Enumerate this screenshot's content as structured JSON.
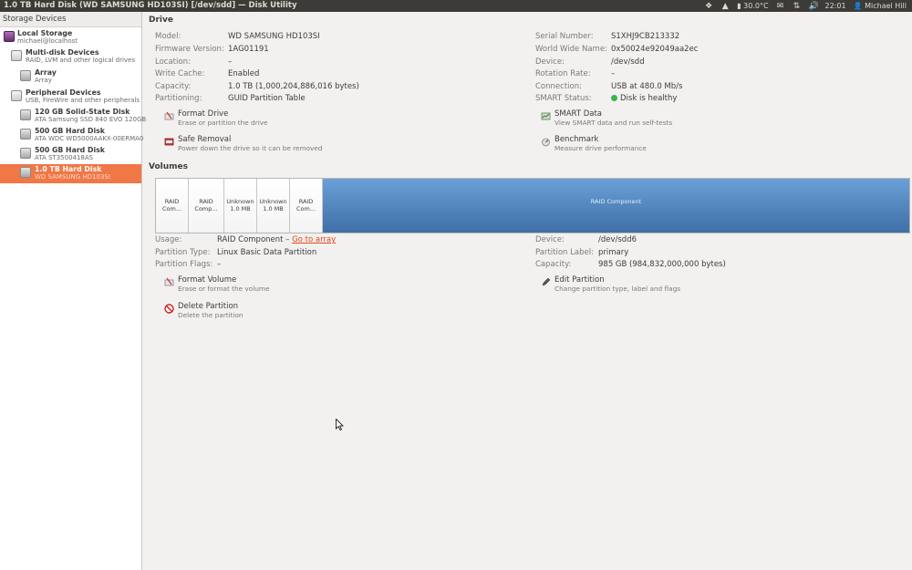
{
  "window": {
    "title": "1.0 TB Hard Disk (WD SAMSUNG HD103SI) [/dev/sdd] — Disk Utility"
  },
  "tray": {
    "temperature": "30.0°C",
    "time": "22:01",
    "user": "Michael Hill"
  },
  "sidebar": {
    "header": "Storage Devices",
    "items": [
      {
        "title": "Local Storage",
        "subtitle": "michael@localhost"
      },
      {
        "title": "Multi-disk Devices",
        "subtitle": "RAID, LVM and other logical drives"
      },
      {
        "title": "Array",
        "subtitle": "Array"
      },
      {
        "title": "Peripheral Devices",
        "subtitle": "USB, FireWire and other peripherals"
      },
      {
        "title": "120 GB Solid-State Disk",
        "subtitle": "ATA Samsung SSD 840 EVO 120GB"
      },
      {
        "title": "500 GB Hard Disk",
        "subtitle": "ATA WDC WD5000AAKX-00ERMA0"
      },
      {
        "title": "500 GB Hard Disk",
        "subtitle": "ATA ST3500418AS"
      },
      {
        "title": "1.0 TB Hard Disk",
        "subtitle": "WD SAMSUNG HD103SI"
      }
    ]
  },
  "drive": {
    "heading": "Drive",
    "left": [
      {
        "label": "Model:",
        "value": "WD SAMSUNG HD103SI"
      },
      {
        "label": "Firmware Version:",
        "value": "1AG01191"
      },
      {
        "label": "Location:",
        "value": "–"
      },
      {
        "label": "Write Cache:",
        "value": "Enabled"
      },
      {
        "label": "Capacity:",
        "value": "1.0 TB (1,000,204,886,016 bytes)"
      },
      {
        "label": "Partitioning:",
        "value": "GUID Partition Table"
      }
    ],
    "right": [
      {
        "label": "Serial Number:",
        "value": "S1XHJ9CB213332"
      },
      {
        "label": "World Wide Name:",
        "value": "0x50024e92049aa2ec"
      },
      {
        "label": "Device:",
        "value": "/dev/sdd"
      },
      {
        "label": "Rotation Rate:",
        "value": "–"
      },
      {
        "label": "Connection:",
        "value": "USB at 480.0 Mb/s"
      },
      {
        "label": "SMART Status:",
        "value": "Disk is healthy"
      }
    ],
    "actions": [
      {
        "title": "Format Drive",
        "desc": "Erase or partition the drive"
      },
      {
        "title": "Safe Removal",
        "desc": "Power down the drive so it can be removed"
      },
      {
        "title": "SMART Data",
        "desc": "View SMART data and run self-tests"
      },
      {
        "title": "Benchmark",
        "desc": "Measure drive performance"
      }
    ]
  },
  "volumes": {
    "heading": "Volumes",
    "segments": [
      {
        "label": "RAID Com..."
      },
      {
        "label": "RAID Comp..."
      },
      {
        "label": "Unknown",
        "size": "1.0 MB"
      },
      {
        "label": "Unknown",
        "size": "1.0 MB"
      },
      {
        "label": "RAID Com..."
      },
      {
        "label": "RAID Component"
      }
    ],
    "usage_label": "Usage:",
    "usage_value": "RAID Component –",
    "usage_link": "Go to array",
    "partition_type_label": "Partition Type:",
    "partition_type_value": "Linux Basic Data Partition",
    "partition_flags_label": "Partition Flags:",
    "partition_flags_value": "–",
    "device_label": "Device:",
    "device_value": "/dev/sdd6",
    "partition_label_label": "Partition Label:",
    "partition_label_value": "primary",
    "capacity_label": "Capacity:",
    "capacity_value": "985 GB (984,832,000,000 bytes)",
    "actions": [
      {
        "title": "Format Volume",
        "desc": "Erase or format the volume"
      },
      {
        "title": "Delete Partition",
        "desc": "Delete the partition"
      },
      {
        "title": "Edit Partition",
        "desc": "Change partition type, label and flags"
      }
    ]
  }
}
